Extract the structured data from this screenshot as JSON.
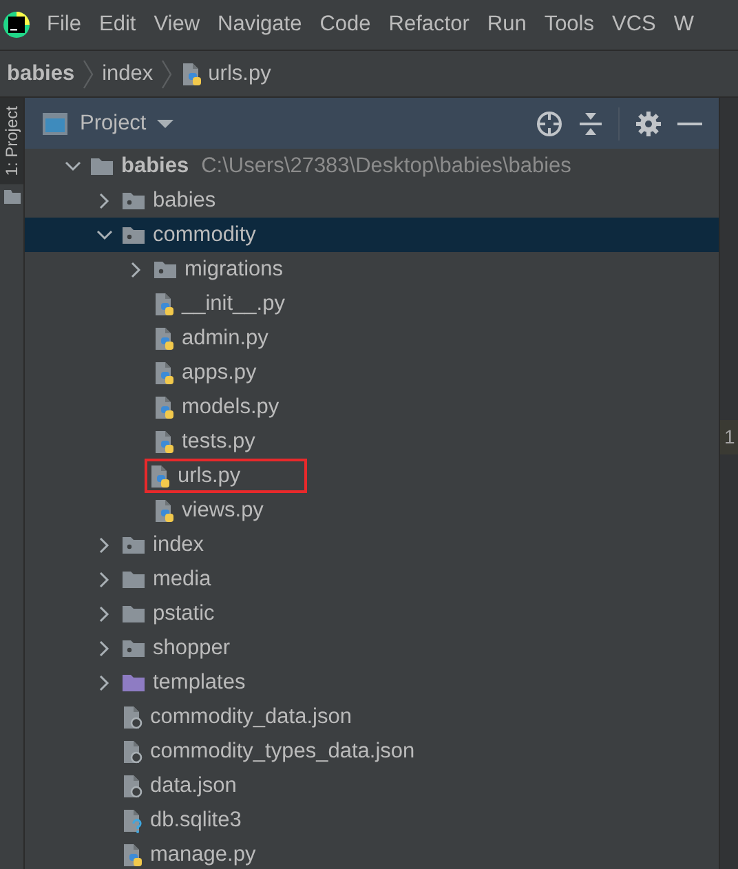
{
  "menu": [
    "File",
    "Edit",
    "View",
    "Navigate",
    "Code",
    "Refactor",
    "Run",
    "Tools",
    "VCS",
    "W"
  ],
  "breadcrumbs": [
    {
      "label": "babies",
      "kind": "project"
    },
    {
      "label": "index",
      "kind": "folder"
    },
    {
      "label": "urls.py",
      "kind": "py"
    }
  ],
  "side_tab": {
    "label": "1: Project",
    "selected": true
  },
  "panel": {
    "title": "Project"
  },
  "tree": [
    {
      "name": "babies",
      "kind": "folder",
      "path": "C:\\Users\\27383\\Desktop\\babies\\babies",
      "expanded": true,
      "selected": false,
      "highlighted": false,
      "children": [
        {
          "name": "babies",
          "kind": "package",
          "expanded": false,
          "selected": false,
          "highlighted": false
        },
        {
          "name": "commodity",
          "kind": "package",
          "expanded": true,
          "selected": true,
          "highlighted": false,
          "children": [
            {
              "name": "migrations",
              "kind": "package",
              "expanded": false,
              "selected": false,
              "highlighted": false
            },
            {
              "name": "__init__.py",
              "kind": "py",
              "selected": false,
              "highlighted": false
            },
            {
              "name": "admin.py",
              "kind": "py",
              "selected": false,
              "highlighted": false
            },
            {
              "name": "apps.py",
              "kind": "py",
              "selected": false,
              "highlighted": false
            },
            {
              "name": "models.py",
              "kind": "py",
              "selected": false,
              "highlighted": false
            },
            {
              "name": "tests.py",
              "kind": "py",
              "selected": false,
              "highlighted": false
            },
            {
              "name": "urls.py",
              "kind": "py",
              "selected": false,
              "highlighted": true
            },
            {
              "name": "views.py",
              "kind": "py",
              "selected": false,
              "highlighted": false
            }
          ]
        },
        {
          "name": "index",
          "kind": "package",
          "expanded": false,
          "selected": false,
          "highlighted": false
        },
        {
          "name": "media",
          "kind": "folder",
          "expanded": false,
          "selected": false,
          "highlighted": false
        },
        {
          "name": "pstatic",
          "kind": "folder",
          "expanded": false,
          "selected": false,
          "highlighted": false
        },
        {
          "name": "shopper",
          "kind": "package",
          "expanded": false,
          "selected": false,
          "highlighted": false
        },
        {
          "name": "templates",
          "kind": "templates",
          "expanded": false,
          "selected": false,
          "highlighted": false
        },
        {
          "name": "commodity_data.json",
          "kind": "json",
          "selected": false,
          "highlighted": false
        },
        {
          "name": "commodity_types_data.json",
          "kind": "json",
          "selected": false,
          "highlighted": false
        },
        {
          "name": "data.json",
          "kind": "json",
          "selected": false,
          "highlighted": false
        },
        {
          "name": "db.sqlite3",
          "kind": "sqlite",
          "selected": false,
          "highlighted": false
        },
        {
          "name": "manage.py",
          "kind": "py",
          "selected": false,
          "highlighted": false
        }
      ]
    }
  ],
  "editor": {
    "line_numbers": [
      "1"
    ]
  }
}
